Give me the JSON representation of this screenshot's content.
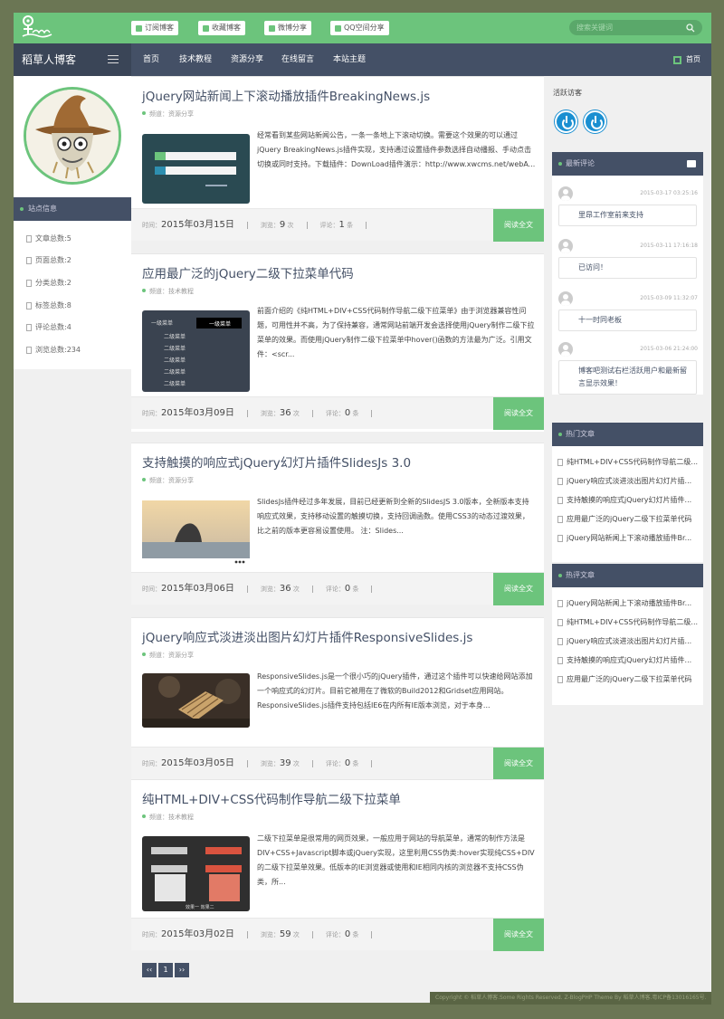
{
  "top_buttons": [
    "订阅博客",
    "收藏博客",
    "微博分享",
    "QQ空间分享"
  ],
  "search": {
    "placeholder": "搜索关键词"
  },
  "nav": {
    "brand": "稻草人博客",
    "items": [
      "首页",
      "技术教程",
      "资源分享",
      "在线留言",
      "本站主题"
    ],
    "right_home": "首页"
  },
  "sidebar_left": {
    "heading": "站点信息",
    "stats": [
      "文章总数:5",
      "页面总数:2",
      "分类总数:2",
      "标签总数:8",
      "评论总数:4",
      "浏览总数:234"
    ]
  },
  "posts": [
    {
      "title": "jQuery网站新闻上下滚动播放插件BreakingNews.js",
      "category": "频道：资源分享",
      "excerpt": "经常看到某些网站新闻公告，一条一条地上下滚动切换。需要这个效果的可以通过jQuery BreakingNews.js插件实现，支持通过设置插件参数选择自动播报、手动点击切换或同时支持。下载插件：DownLoad插件演示：http://www.xwcms.net/webA...",
      "time_label": "时间：",
      "date": "2015年03月15日",
      "views_label": "浏览：",
      "views": "9",
      "views_unit": "次",
      "comments_label": "评论：",
      "comments": "1",
      "comments_unit": "条",
      "more": "阅读全文"
    },
    {
      "title": "应用最广泛的jQuery二级下拉菜单代码",
      "category": "频道：技术教程",
      "excerpt": "前面介绍的《纯HTML+DIV+CSS代码制作导航二级下拉菜单》由于浏览器兼容性问题，可用性并不高，为了保持兼容，通常网站前端开发会选择使用jQuery制作二级下拉菜单的效果。而使用jQuery制作二级下拉菜单中hover()函数的方法最为广泛。引用文件：<scr...",
      "time_label": "时间：",
      "date": "2015年03月09日",
      "views_label": "浏览：",
      "views": "36",
      "views_unit": "次",
      "comments_label": "评论：",
      "comments": "0",
      "comments_unit": "条",
      "more": "阅读全文"
    },
    {
      "title": "支持触摸的响应式jQuery幻灯片插件SlidesJs 3.0",
      "category": "频道：资源分享",
      "excerpt": "SlidesJs插件经过多年发展，目前已经更新到全新的SlidesJS 3.0版本，全新版本支持响应式效果，支持移动设置的触摸切换，支持回调函数。使用CSS3的动态过渡效果，比之前的版本更容易设置使用。 注：Slides...",
      "time_label": "时间：",
      "date": "2015年03月06日",
      "views_label": "浏览：",
      "views": "36",
      "views_unit": "次",
      "comments_label": "评论：",
      "comments": "0",
      "comments_unit": "条",
      "more": "阅读全文"
    },
    {
      "title": "jQuery响应式淡进淡出图片幻灯片插件ResponsiveSlides.js",
      "category": "频道：资源分享",
      "excerpt": "ResponsiveSlides.js是一个很小巧的jQuery插件，通过这个插件可以快速给网站添加一个响应式的幻灯片。目前它被用在了微软的Build2012和Gridset应用网站。ResponsiveSlides.js插件支持包括IE6在内所有IE版本浏览，对于本身...",
      "time_label": "时间：",
      "date": "2015年03月05日",
      "views_label": "浏览：",
      "views": "39",
      "views_unit": "次",
      "comments_label": "评论：",
      "comments": "0",
      "comments_unit": "条",
      "more": "阅读全文"
    },
    {
      "title": "纯HTML+DIV+CSS代码制作导航二级下拉菜单",
      "category": "频道：技术教程",
      "excerpt": "二级下拉菜单是很常用的网页效果，一般应用于网站的导航菜单，通常的制作方法是DIV+CSS+Javascript脚本或jQuery实现，这里利用CSS伪类:hover实现纯CSS+DIV的二级下拉菜单效果。低版本的IE浏览器或使用和IE相同内核的浏览器不支持CSS伪类，所...",
      "time_label": "时间：",
      "date": "2015年03月02日",
      "views_label": "浏览：",
      "views": "59",
      "views_unit": "次",
      "comments_label": "评论：",
      "comments": "0",
      "comments_unit": "条",
      "more": "阅读全文"
    }
  ],
  "thumb_text": {
    "menu_items": [
      "一级菜单",
      "二级菜单",
      "二级菜单",
      "二级菜单",
      "二级菜单",
      "二级菜单"
    ],
    "menu_active": "一级菜单",
    "css_menu_caption": "效果一 效果二"
  },
  "pager": [
    "‹‹",
    "1",
    "››"
  ],
  "sidebar_right": {
    "visitors_title": "活跃访客",
    "latest_comments_title": "最新评论",
    "comments": [
      {
        "time": "2015-03-17 03:25:16",
        "text": "里昂工作室前来支持"
      },
      {
        "time": "2015-03-11 17:16:18",
        "text": "已访问！"
      },
      {
        "time": "2015-03-09 11:32:07",
        "text": "十一时同老板"
      },
      {
        "time": "2015-03-06 21:24:00",
        "text": "博客吧测试右栏活跃用户和最新留言显示效果！"
      }
    ],
    "hot_title": "热门文章",
    "hot": [
      "纯HTML+DIV+CSS代码制作导航二级...",
      "jQuery响应式淡进淡出图片幻灯片插...",
      "支持触摸的响应式jQuery幻灯片插件...",
      "应用最广泛的jQuery二级下拉菜单代码",
      "jQuery网站新闻上下滚动播放插件Br..."
    ],
    "heat_title": "热评文章",
    "heat": [
      "jQuery网站新闻上下滚动播放插件Br...",
      "纯HTML+DIV+CSS代码制作导航二级...",
      "jQuery响应式淡进淡出图片幻灯片插...",
      "支持触摸的响应式jQuery幻灯片插件...",
      "应用最广泛的jQuery二级下拉菜单代码"
    ]
  },
  "footer": "Copyright © 稻草人博客.Some Rights Reserved. Z-BlogPHP Theme By 稻草人博客.粤ICP备13016165号.",
  "colors": {
    "green": "#6cc47c",
    "navy": "#445066",
    "outer": "#6b7654"
  }
}
